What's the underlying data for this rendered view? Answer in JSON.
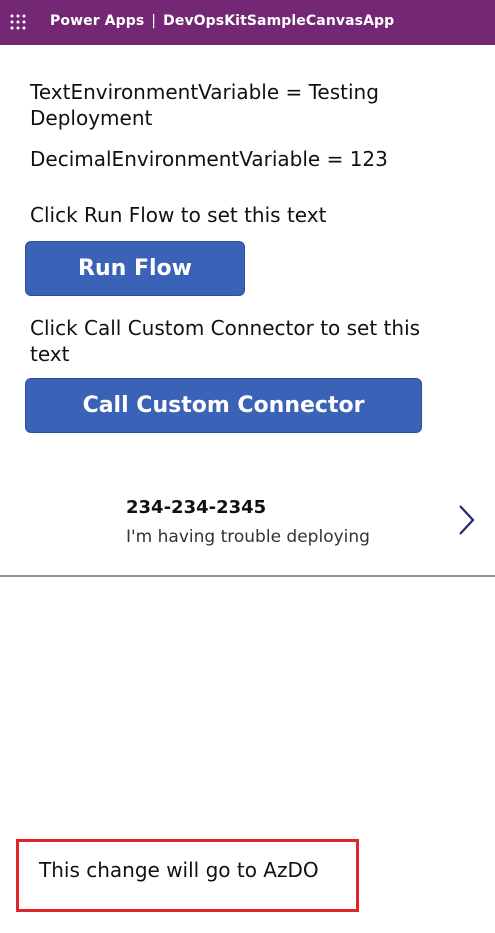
{
  "header": {
    "brand": "Power Apps",
    "separator": "|",
    "app_name": "DevOpsKitSampleCanvasApp",
    "icons": {
      "waffle": "waffle-grid-icon"
    },
    "background_color": "#742774"
  },
  "main": {
    "text_env_var": "TextEnvironmentVariable = Testing Deployment",
    "decimal_env_var": "DecimalEnvironmentVariable = 123",
    "run_flow_prompt": "Click Run Flow to set this text",
    "run_flow_button": "Run Flow",
    "custom_connector_prompt": "Click Call Custom Connector to set this text",
    "custom_connector_button": "Call Custom Connector",
    "button_color": "#3a62b6"
  },
  "gallery": {
    "items": [
      {
        "title": "234-234-2345",
        "subtitle": "I'm having trouble deploying",
        "icon": "chevron-right-icon"
      }
    ]
  },
  "footer_note": {
    "text": "This change will go to AzDO",
    "border_color": "#e0262c"
  }
}
